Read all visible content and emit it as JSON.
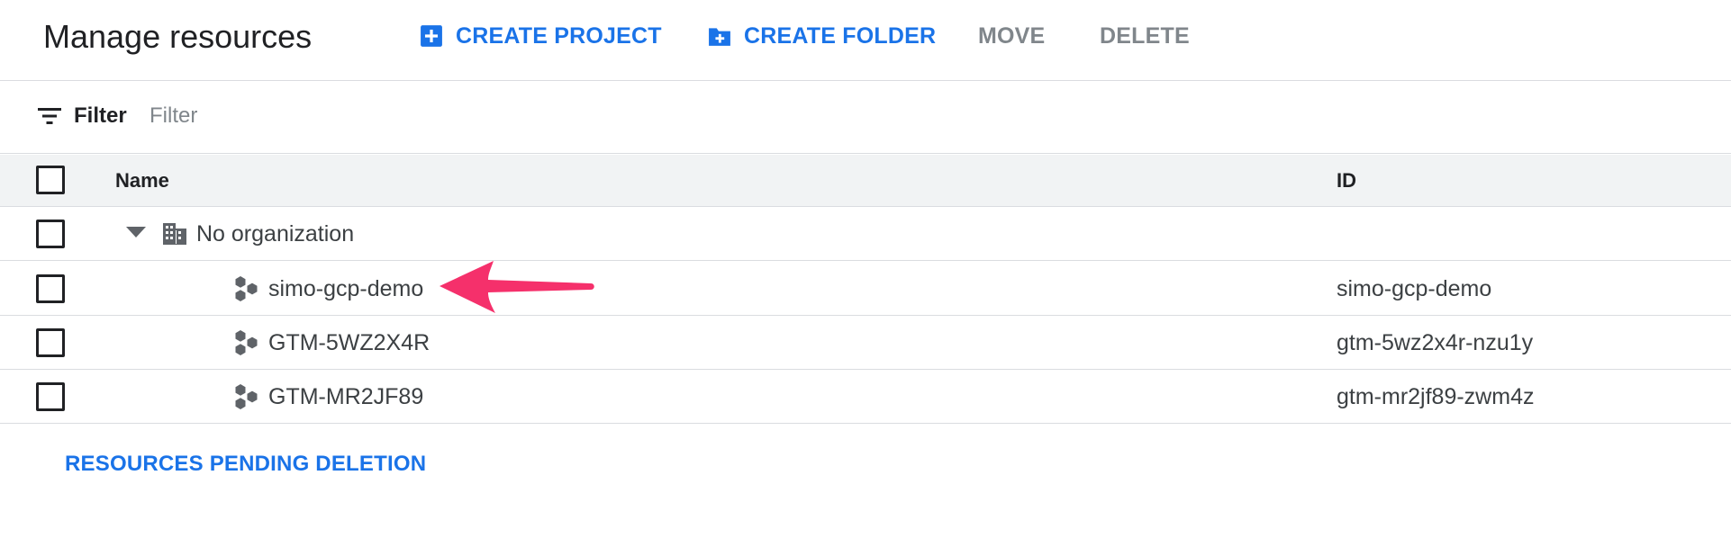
{
  "header": {
    "title": "Manage resources",
    "actions": {
      "create_project": "CREATE PROJECT",
      "create_folder": "CREATE FOLDER",
      "move": "MOVE",
      "delete": "DELETE"
    }
  },
  "filter": {
    "label": "Filter",
    "placeholder": "Filter",
    "value": ""
  },
  "table": {
    "columns": {
      "name": "Name",
      "id": "ID"
    },
    "organization": {
      "name": "No organization",
      "expanded": true
    },
    "rows": [
      {
        "name": "simo-gcp-demo",
        "id": "simo-gcp-demo",
        "icon": "project-icon",
        "annotated": true
      },
      {
        "name": "GTM-5WZ2X4R",
        "id": "gtm-5wz2x4r-nzu1y",
        "icon": "project-icon",
        "annotated": false
      },
      {
        "name": "GTM-MR2JF89",
        "id": "gtm-mr2jf89-zwm4z",
        "icon": "project-icon",
        "annotated": false
      }
    ]
  },
  "footer": {
    "pending_deletion": "RESOURCES PENDING DELETION"
  },
  "colors": {
    "accent": "#1a73e8",
    "disabled": "#80868b",
    "annotation": "#f5306b",
    "header_bg": "#f1f3f4"
  }
}
